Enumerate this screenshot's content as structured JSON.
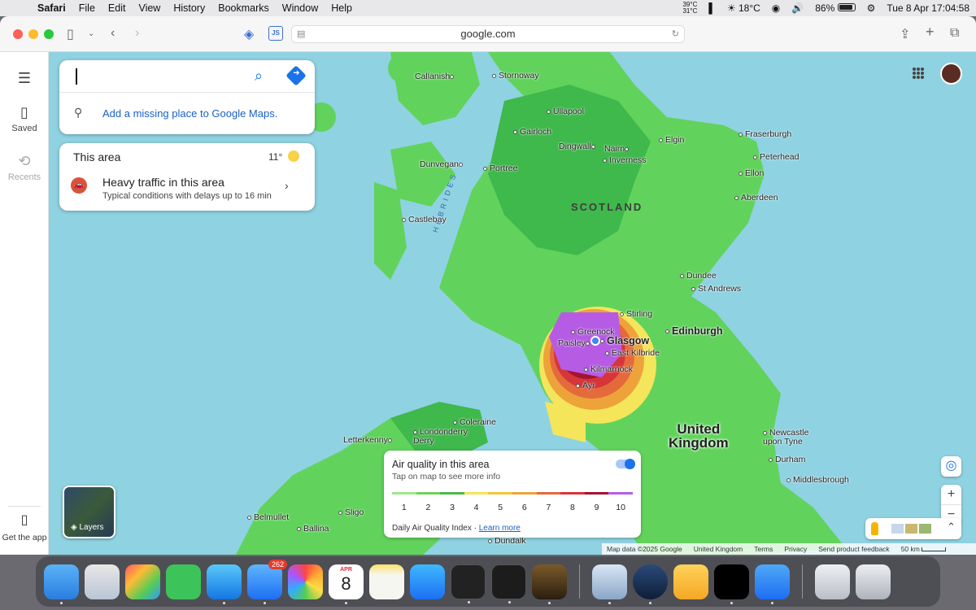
{
  "menubar": {
    "app": "Safari",
    "menus": [
      "File",
      "Edit",
      "View",
      "History",
      "Bookmarks",
      "Window",
      "Help"
    ],
    "temp_high": "39°C",
    "temp_low": "31°C",
    "weather": "18°C",
    "battery": "86%",
    "clock": "Tue 8 Apr  17:04:58"
  },
  "browser": {
    "address": "google.com",
    "js_badge": "JS"
  },
  "rail": {
    "saved": "Saved",
    "recents": "Recents",
    "get_app": "Get the app"
  },
  "search": {
    "placeholder": "",
    "add_place": "Add a missing place to Google Maps."
  },
  "area": {
    "title": "This area",
    "temperature": "11°",
    "traffic_title": "Heavy traffic in this area",
    "traffic_sub": "Typical conditions with delays up to 16 min"
  },
  "map": {
    "region": "SCOTLAND",
    "country_line1": "United",
    "country_line2": "Kingdom",
    "hebrides": "HEBRIDES",
    "places": [
      {
        "name": "Callanish"
      },
      {
        "name": "Stornoway"
      },
      {
        "name": "Ullapool"
      },
      {
        "name": "Gairloch"
      },
      {
        "name": "Dingwall"
      },
      {
        "name": "Nairn"
      },
      {
        "name": "Inverness"
      },
      {
        "name": "Elgin"
      },
      {
        "name": "Fraserburgh"
      },
      {
        "name": "Peterhead"
      },
      {
        "name": "Ellon"
      },
      {
        "name": "Aberdeen"
      },
      {
        "name": "Dunvegan"
      },
      {
        "name": "Portree"
      },
      {
        "name": "Castlebay"
      },
      {
        "name": "Dundee"
      },
      {
        "name": "St Andrews"
      },
      {
        "name": "Stirling"
      },
      {
        "name": "Greenock"
      },
      {
        "name": "Glasgow"
      },
      {
        "name": "Paisley"
      },
      {
        "name": "Edinburgh"
      },
      {
        "name": "East Kilbride"
      },
      {
        "name": "Kilmarnock"
      },
      {
        "name": "Ayr"
      },
      {
        "name": "Coleraine"
      },
      {
        "name": "Letterkenny"
      },
      {
        "name": "Londonderry Derry"
      },
      {
        "name": "Newcastle upon Tyne"
      },
      {
        "name": "Durham"
      },
      {
        "name": "Middlesbrough"
      },
      {
        "name": "Belmullet"
      },
      {
        "name": "Sligo"
      },
      {
        "name": "Ballina"
      },
      {
        "name": "Dundalk"
      }
    ],
    "layers_label": "Layers",
    "attribution": [
      "Map data ©2025 Google",
      "United Kingdom",
      "Terms",
      "Privacy",
      "Send product feedback"
    ],
    "scale": "50 km"
  },
  "air_quality": {
    "title": "Air quality in this area",
    "subtitle": "Tap on map to see more info",
    "enabled": true,
    "scale_values": [
      "1",
      "2",
      "3",
      "4",
      "5",
      "6",
      "7",
      "8",
      "9",
      "10"
    ],
    "scale_colors": [
      "#9ee88b",
      "#6fd15a",
      "#4cb84a",
      "#f4e55a",
      "#f3c53a",
      "#eea23a",
      "#e46a3c",
      "#d6353a",
      "#a3152e",
      "#b65ce4"
    ],
    "index_label": "Daily Air Quality Index ·",
    "learn_more": "Learn more"
  },
  "dock": {
    "mail_badge": "262",
    "calendar_month": "APR",
    "calendar_day": "8"
  }
}
